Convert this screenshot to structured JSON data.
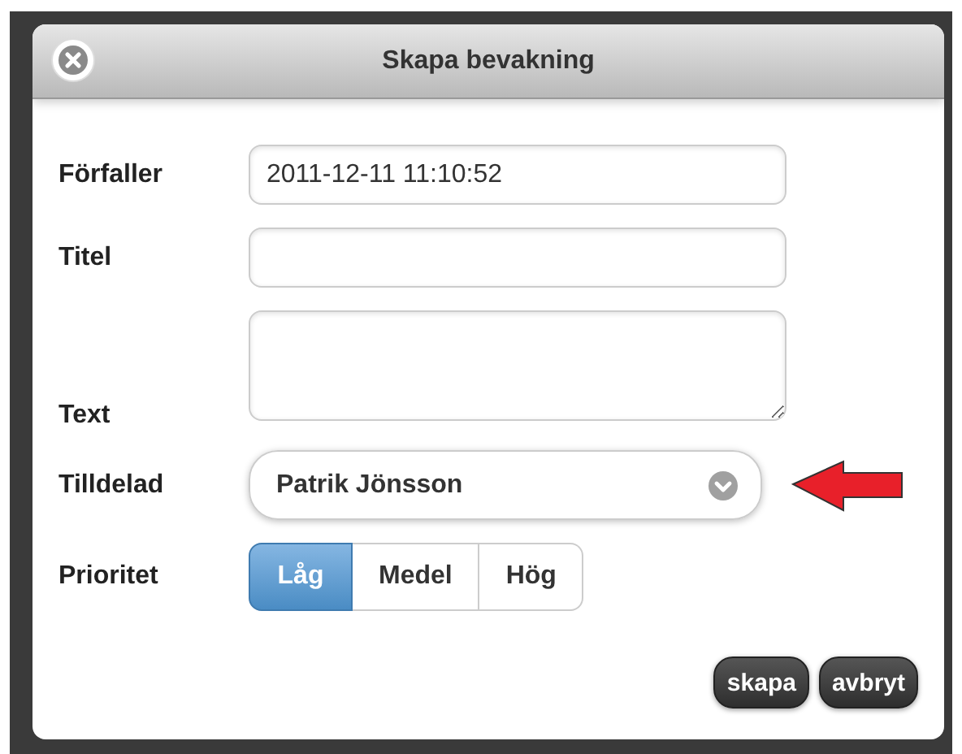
{
  "dialog": {
    "title": "Skapa bevakning"
  },
  "fields": [
    {
      "kind": "input",
      "label": "Förfaller",
      "value": "2011-12-11 11:10:52"
    },
    {
      "kind": "input",
      "label": "Titel"
    },
    {
      "kind": "textarea",
      "label": "Text"
    },
    {
      "kind": "select",
      "label": "Tilldelad",
      "value": "Patrik Jönsson"
    },
    {
      "kind": "segmented",
      "label": "Prioritet",
      "options": [
        {
          "label": "Låg",
          "selected": true
        },
        {
          "label": "Medel",
          "selected": false
        },
        {
          "label": "Hög",
          "selected": false
        }
      ]
    }
  ],
  "buttons": [
    "skapa",
    "avbryt"
  ]
}
